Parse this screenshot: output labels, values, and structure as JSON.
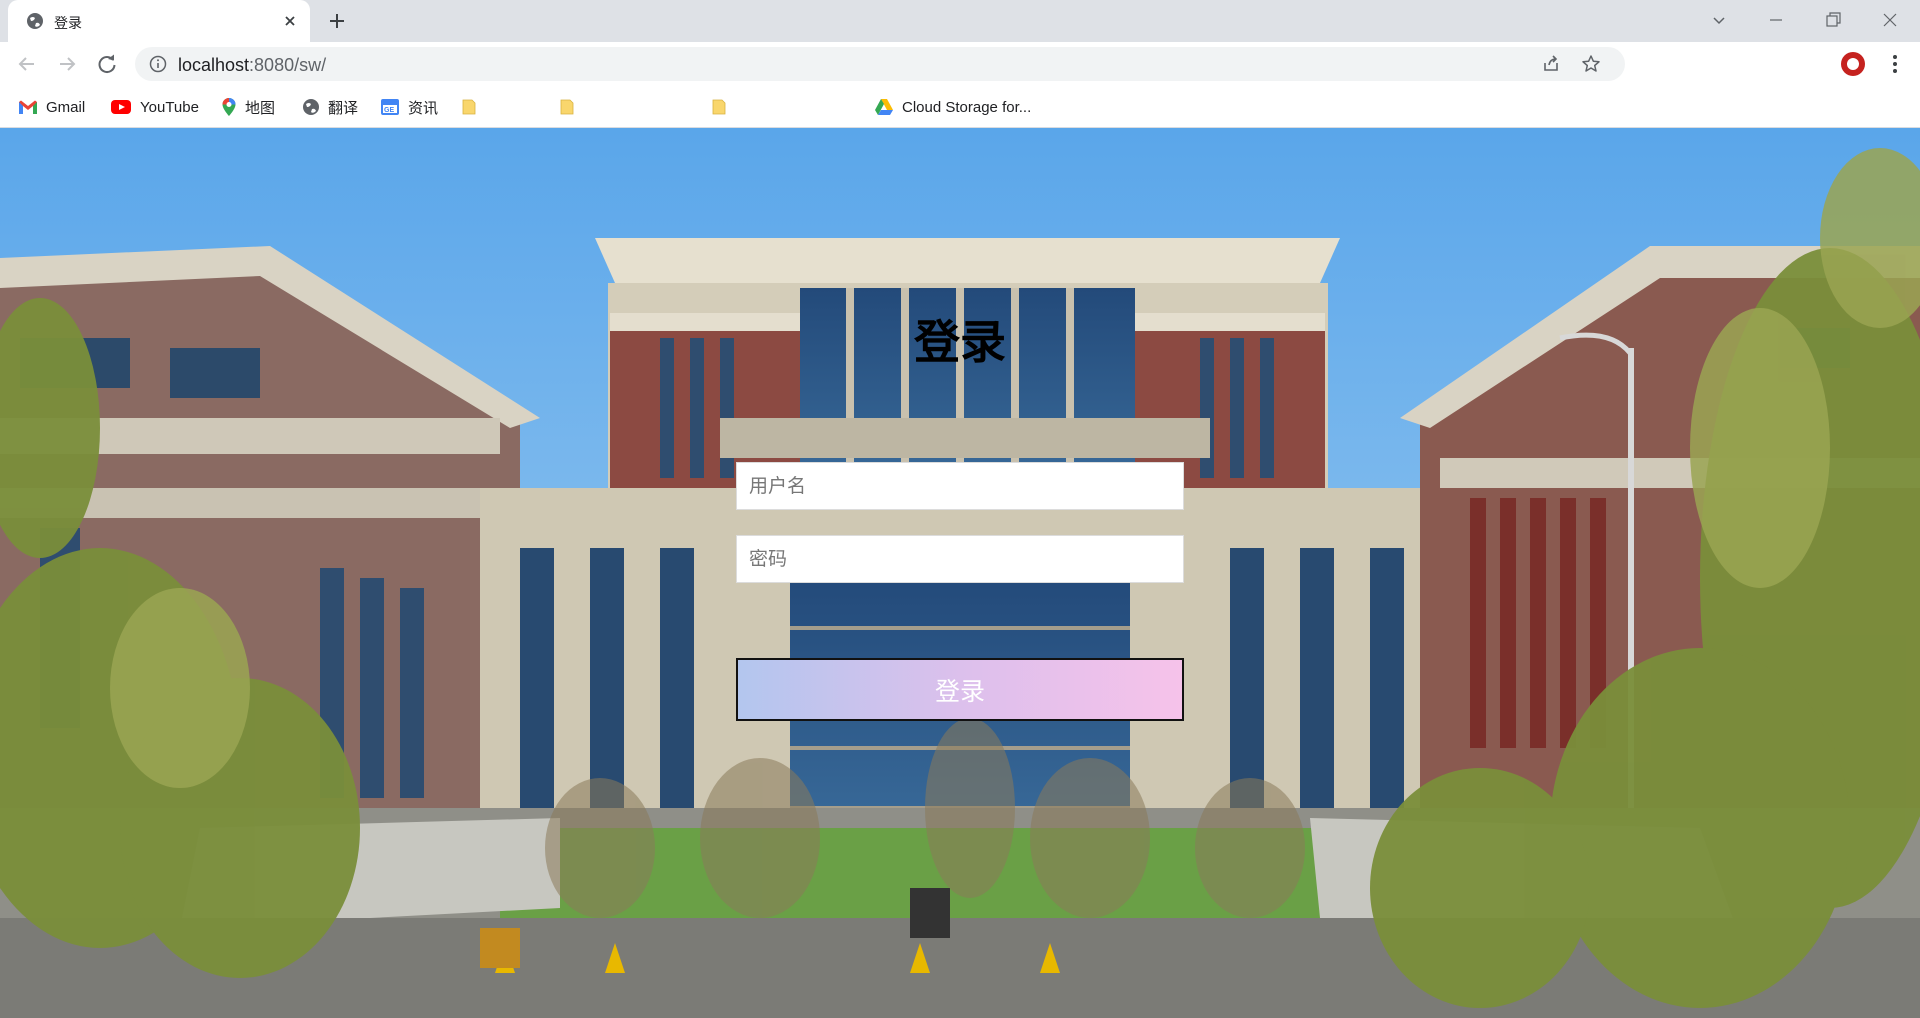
{
  "browser": {
    "tab": {
      "title": "登录",
      "favicon": "globe-icon"
    },
    "url": {
      "host": "localhost",
      "path": ":8080/sw/"
    },
    "bookmarks": [
      {
        "label": "Gmail",
        "icon": "gmail-icon"
      },
      {
        "label": "YouTube",
        "icon": "youtube-icon"
      },
      {
        "label": "地图",
        "icon": "maps-icon"
      },
      {
        "label": "翻译",
        "icon": "globe-icon"
      },
      {
        "label": "资讯",
        "icon": "news-icon"
      },
      {
        "label": "",
        "icon": "folder-icon"
      },
      {
        "label": "",
        "icon": "folder-icon"
      },
      {
        "label": "",
        "icon": "folder-icon"
      },
      {
        "label": "Cloud Storage for...",
        "icon": "google-drive-icon"
      }
    ],
    "colors": {
      "tabstrip": "#dee1e6",
      "omnibox": "#f1f3f4",
      "profile": "#c5221f"
    }
  },
  "login": {
    "title": "登录",
    "username_placeholder": "用户名",
    "password_placeholder": "密码",
    "submit_label": "登录",
    "button_gradient": [
      "#b3c6ee",
      "#f6c2ea"
    ]
  }
}
